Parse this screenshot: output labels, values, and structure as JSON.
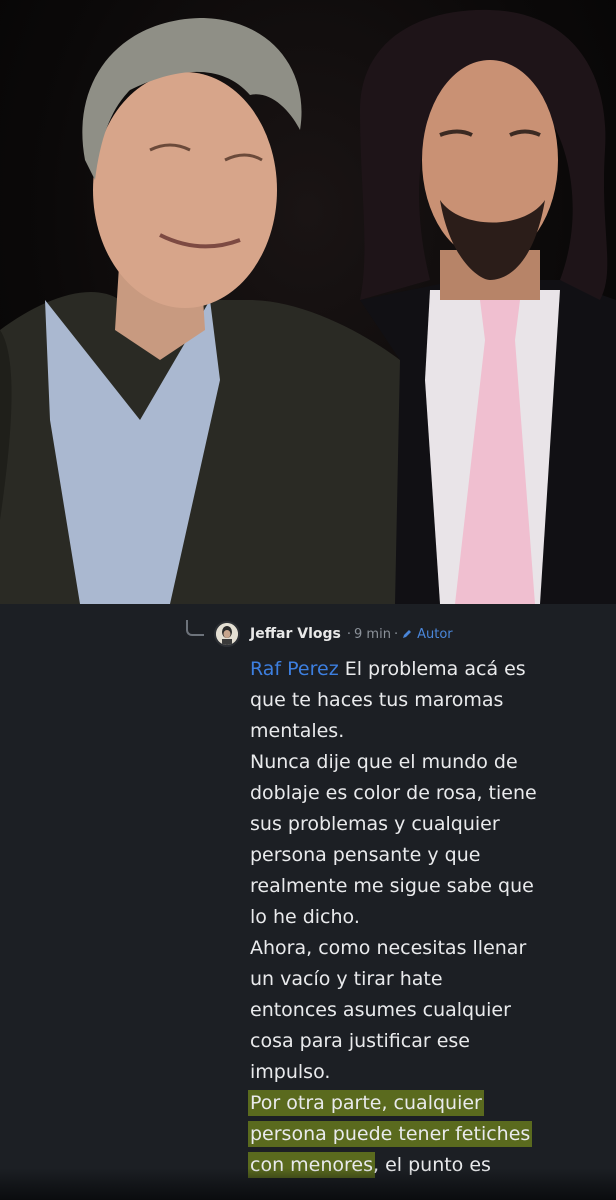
{
  "comment": {
    "author": "Jeffar Vlogs",
    "time": "9 min",
    "badge": "Autor",
    "mention": "Raf Perez",
    "lines": [
      " El problema acá es",
      "que te haces tus maromas",
      "mentales.",
      "Nunca dije que el mundo de",
      "doblaje es color de rosa, tiene",
      "sus problemas y cualquier",
      "persona pensante y que",
      "realmente me sigue sabe que",
      "lo he dicho.",
      "Ahora, como necesitas llenar",
      "un vacío y tirar hate",
      "entonces asumes cualquier",
      "cosa para justificar ese",
      "impulso.",
      "Por otra parte, cualquier",
      "persona puede tener fetiches",
      "con menores",
      ", el punto es"
    ]
  },
  "colors": {
    "mention": "#3d7fe0",
    "highlight": "#5a6a1e",
    "panel_background": "#1c1f24",
    "text": "#e9eaec"
  },
  "icons": {
    "avatar": "avatar-icon",
    "author_badge": "pencil-icon"
  }
}
